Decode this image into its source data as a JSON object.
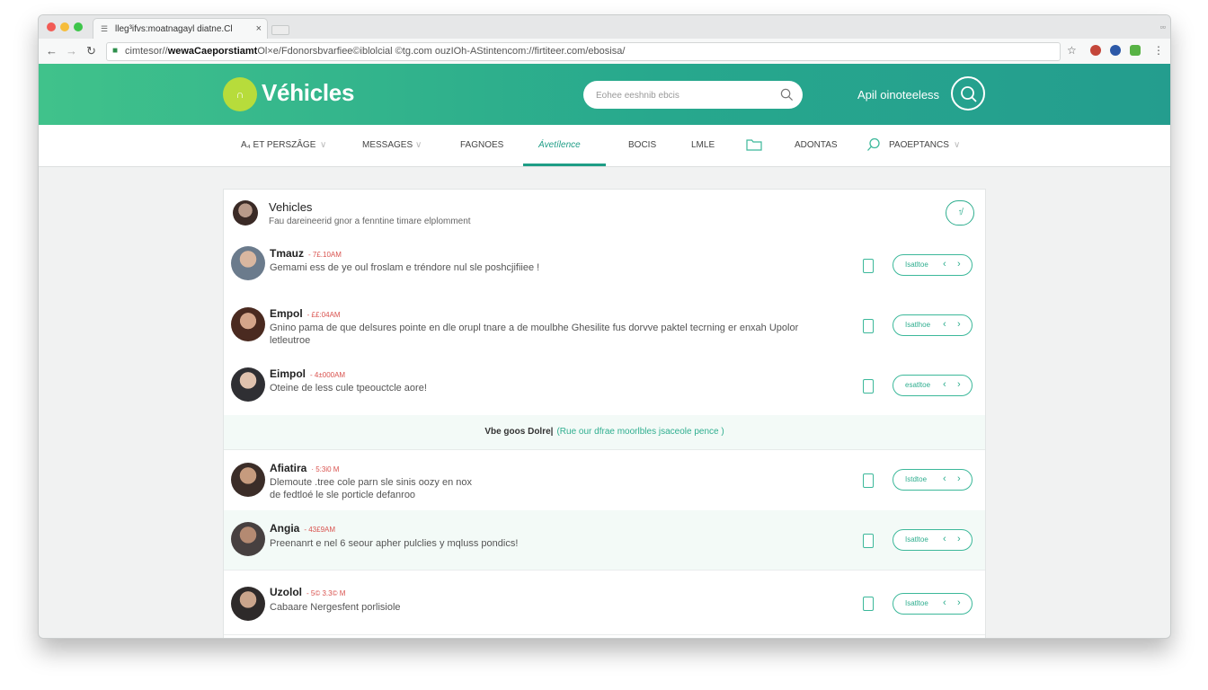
{
  "browser": {
    "tab_icon": "☰",
    "tab_title": "lleg³ifvs:moatnagayl diatne.Cl",
    "tab_close": "×",
    "window_controls": "▫▫",
    "back": "←",
    "forward": "→",
    "reload": "↻",
    "lock": "■",
    "url_prefix": "cimtesor//",
    "url_bold": "wewaCaeporstiamt",
    "url_rest": "Ol×e/Fdonorsbvarfiee©iblolcial ©tg.com ouzIOh-AStintencom://firtiteer.com/ebosisa/",
    "star": "☆",
    "menu": "⋮"
  },
  "header": {
    "logo_glyph": "∩",
    "title": "Véhicles",
    "search_placeholder": "Eohee eeshnib ebcis",
    "link": "Apil oinoteeless"
  },
  "nav": {
    "tabs": [
      {
        "label": "A₄ ET PERSZÂGE"
      },
      {
        "label": "MESSAGES"
      },
      {
        "label": "FAGNOES"
      },
      {
        "label": "Ávetílence"
      },
      {
        "label": "BOCIS"
      },
      {
        "label": "LMLE"
      },
      {
        "label": "ADONTAS"
      },
      {
        "label": "PAOEPTANCS"
      }
    ],
    "chevron": "∨"
  },
  "list": {
    "header": {
      "title": "Vehicles",
      "subtitle": "Fau dareineerid gnor a fenntine timare elplomment",
      "button_glyph": "↑̸"
    },
    "rows": [
      {
        "name": "Tmauz",
        "time": "- 7£.10AM",
        "message": "Gemami ess de ye oul froslam e tréndore nul sle poshcjifiiee !",
        "action": "Isatltoe"
      },
      {
        "name": "Empol",
        "time": "- ££:04AM",
        "message": "Gnino pama de que delsures pointe en dle orupl tnare a de moulbhe Ghesilite fus dorvve paktel tecrning er enxah Upolor letleutroe",
        "action": "Isatlhoe"
      },
      {
        "name": "Eimpol",
        "time": "- 4±000AM",
        "message": "Oteine de less cule tpeouctcle aore!",
        "action": "esatltoe"
      },
      {
        "name": "Afiatira",
        "time": "· 5:3i0 M",
        "message": "Dlemoute .tree cole parn sle sinis oozy en nox de fedtloé le sle porticle defanroo",
        "action": "Istdtoe"
      },
      {
        "name": "Angia",
        "time": "- 43£9AM",
        "message": "Preenanrt e nel 6 seour apher pulclies y mqluss pondics!",
        "action": "Isatltoe"
      },
      {
        "name": "Uzolol",
        "time": "- 5© 3.3© M",
        "message": "Cabaare Nergesfent porlisiole",
        "action": "Isatltoe"
      }
    ],
    "divider": {
      "bold": "Vbe goos Dolre|",
      "text": "(Rue our dfrae moorlbles jsaceole pence )"
    },
    "prev_arrow": "‹",
    "next_arrow": "›"
  }
}
